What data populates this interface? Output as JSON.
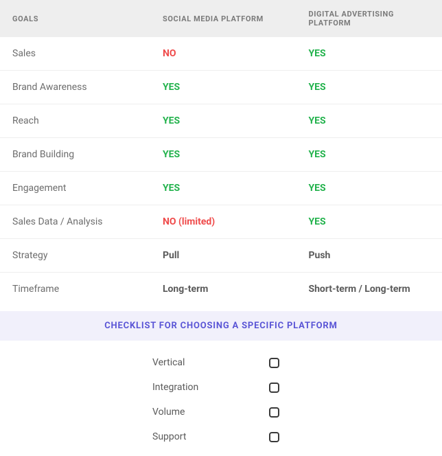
{
  "columns": {
    "goals": "GOALS",
    "social": "SOCIAL MEDIA PLATFORM",
    "digital": "DIGITAL ADVERTISING PLATFORM"
  },
  "rows": [
    {
      "goal": "Sales",
      "social": "NO",
      "social_kind": "no",
      "digital": "YES",
      "digital_kind": "yes"
    },
    {
      "goal": "Brand Awareness",
      "social": "YES",
      "social_kind": "yes",
      "digital": "YES",
      "digital_kind": "yes"
    },
    {
      "goal": "Reach",
      "social": "YES",
      "social_kind": "yes",
      "digital": "YES",
      "digital_kind": "yes"
    },
    {
      "goal": "Brand Building",
      "social": "YES",
      "social_kind": "yes",
      "digital": "YES",
      "digital_kind": "yes"
    },
    {
      "goal": "Engagement",
      "social": "YES",
      "social_kind": "yes",
      "digital": "YES",
      "digital_kind": "yes"
    },
    {
      "goal": "Sales Data / Analysis",
      "social": "NO (limited)",
      "social_kind": "no",
      "digital": "YES",
      "digital_kind": "yes"
    },
    {
      "goal": "Strategy",
      "social": "Pull",
      "social_kind": "plain",
      "digital": "Push",
      "digital_kind": "plain"
    },
    {
      "goal": "Timeframe",
      "social": "Long-term",
      "social_kind": "plain",
      "digital": "Short-term / Long-term",
      "digital_kind": "plain"
    }
  ],
  "checklist": {
    "title": "CHECKLIST FOR CHOOSING A SPECIFIC PLATFORM",
    "items": [
      "Vertical",
      "Integration",
      "Volume",
      "Support"
    ]
  },
  "chart_data": {
    "type": "table",
    "columns": [
      "GOALS",
      "SOCIAL MEDIA PLATFORM",
      "DIGITAL ADVERTISING PLATFORM"
    ],
    "rows": [
      [
        "Sales",
        "NO",
        "YES"
      ],
      [
        "Brand Awareness",
        "YES",
        "YES"
      ],
      [
        "Reach",
        "YES",
        "YES"
      ],
      [
        "Brand Building",
        "YES",
        "YES"
      ],
      [
        "Engagement",
        "YES",
        "YES"
      ],
      [
        "Sales Data / Analysis",
        "NO (limited)",
        "YES"
      ],
      [
        "Strategy",
        "Pull",
        "Push"
      ],
      [
        "Timeframe",
        "Long-term",
        "Short-term / Long-term"
      ]
    ]
  }
}
